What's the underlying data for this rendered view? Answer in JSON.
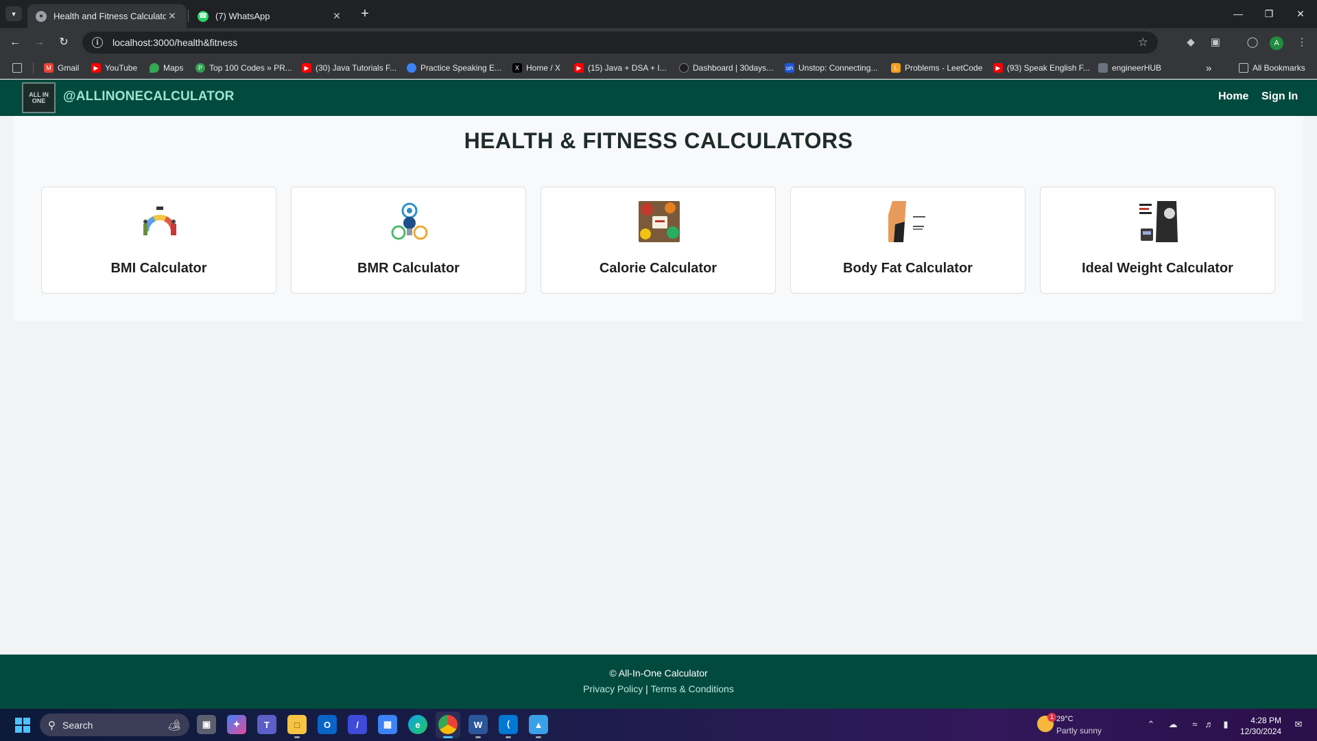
{
  "browser": {
    "tabs": [
      {
        "title": "Health and Fitness Calculators",
        "active": true
      },
      {
        "title": "(7) WhatsApp",
        "active": false
      }
    ],
    "url": "localhost:3000/health&fitness",
    "profile_initial": "A",
    "bookmarks": [
      {
        "label": "Gmail",
        "icon": "gmail-icon"
      },
      {
        "label": "YouTube",
        "icon": "youtube-icon"
      },
      {
        "label": "Maps",
        "icon": "maps-icon"
      },
      {
        "label": "Top 100 Codes » PR...",
        "icon": "site-icon"
      },
      {
        "label": "(30) Java Tutorials F...",
        "icon": "youtube-icon"
      },
      {
        "label": "Practice Speaking E...",
        "icon": "site-icon"
      },
      {
        "label": "Home / X",
        "icon": "x-icon"
      },
      {
        "label": "(15) Java + DSA + I...",
        "icon": "youtube-icon"
      },
      {
        "label": "Dashboard | 30days...",
        "icon": "site-icon"
      },
      {
        "label": "Unstop: Connecting...",
        "icon": "unstop-icon"
      },
      {
        "label": "Problems - LeetCode",
        "icon": "leetcode-icon"
      },
      {
        "label": "(93) Speak English F...",
        "icon": "youtube-icon"
      },
      {
        "label": "engineerHUB",
        "icon": "site-icon"
      }
    ],
    "all_bookmarks_label": "All Bookmarks"
  },
  "header": {
    "logo_text": "@ALLINONECALCULATOR",
    "logo_image_text": "ALL IN ONE",
    "nav": {
      "home": "Home",
      "sign_in": "Sign In"
    }
  },
  "main": {
    "title": "HEALTH & FITNESS CALCULATORS",
    "cards": [
      {
        "label": "BMI Calculator"
      },
      {
        "label": "BMR Calculator"
      },
      {
        "label": "Calorie Calculator"
      },
      {
        "label": "Body Fat Calculator"
      },
      {
        "label": "Ideal Weight Calculator"
      }
    ]
  },
  "footer": {
    "copyright": "© All-In-One Calculator",
    "privacy": "Privacy Policy",
    "separator": " | ",
    "terms": "Terms & Conditions"
  },
  "taskbar": {
    "search_label": "Search",
    "weather": {
      "temp": "29°C",
      "desc": "Partly sunny",
      "badge": "1"
    },
    "time": "4:28 PM",
    "date": "12/30/2024"
  },
  "colors": {
    "header_bg": "#034a3e",
    "logo_text": "#9fe3cf",
    "card_border": "#dcdfe2"
  }
}
